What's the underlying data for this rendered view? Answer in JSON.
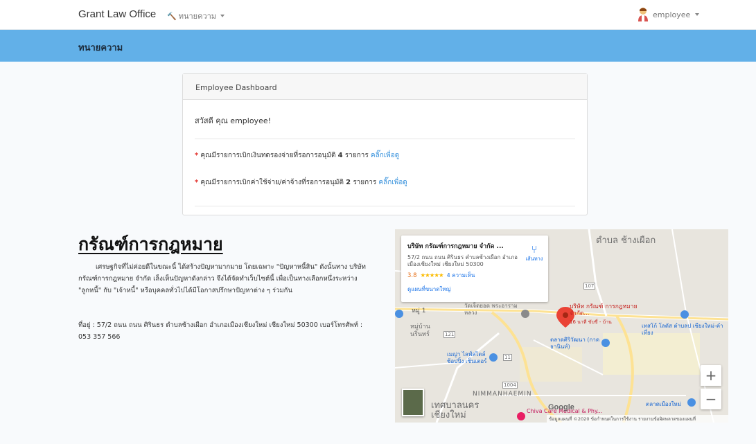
{
  "navbar": {
    "brand": "Grant Law Office",
    "menu_label": "ทนายความ",
    "user_label": "employee"
  },
  "band": {
    "title": "ทนายความ"
  },
  "card": {
    "header": "Employee Dashboard",
    "greeting": "สวัสดี คุณ employee!",
    "notice1": {
      "star": "*",
      "text_before": "คุณมีรายการเบิกเงินทดรองจ่ายที่รอการอนุมัติ",
      "count": "4",
      "text_after": "รายการ",
      "link": "คลิ๊กเพื่อดู"
    },
    "notice2": {
      "star": "*",
      "text_before": "คุณมีรายการเบิกค่าใช้จ่าย/ค่าจ้างที่รอการอนุมัติ",
      "count": "2",
      "text_after": "รายการ",
      "link": "คลิ๊กเพื่อดู"
    }
  },
  "company": {
    "title": "กรัณฑ์การกฎหมาย",
    "description": "เศรษฐกิจที่ไม่ค่อยดีในขณะนี้ ได้สร้างปัญหามากมาย โดยเฉพาะ \"ปัญหาหนี้สิน\" ดังนั้นทาง บริษัท กรัณฑ์การกฎหมาย จำกัด เล็งเห็นปัญหาดังกล่าว จึงได้จัดทำเว็บไซต์นี้ เพื่อเป็นทางเลือกหนึ่งระหว่าง \"ลูกหนี้\" กับ \"เจ้าหนี้\" หรือบุคคลทั่วไปได้มีโอกาสปรึกษาปัญหาต่าง ๆ ร่วมกัน",
    "address": "ที่อยู่ : 57/2 ถนน ถนน ศิรินธร ตำบลช้างเผือก อำเภอเมืองเชียงใหม่ เชียงใหม่ 50300 เบอร์โทรศัพท์ : 053 357 566"
  },
  "map": {
    "info_name": "บริษัท กรัณฑ์การกฎหมาย จำกัด ...",
    "info_address": "57/2 ถนน ถนน ศิรินธร ตำบลช้างเผือก อำเภอเมืองเชียงใหม่ เชียงใหม่ 50300",
    "rating": "3.8",
    "stars": "★★★★★",
    "reviews": "4 ความเห็น",
    "larger_map": "ดูแผนที่ขนาดใหญ่",
    "directions": "เส้นทาง",
    "zoom_in": "+",
    "zoom_out": "−",
    "google": "Google",
    "footer": "ข้อมูลแผนที่ ©2020   ข้อกำหนดในการใช้งาน   รายงานข้อผิดพลาดของแผนที่",
    "labels": {
      "chang_phueak": "ตำบล ช้างเผือก",
      "moo1": "หมู่ 1",
      "wat": "วัดเจ็ดยอด พระอารามหลวง",
      "moo_ban": "หมู่บ้าน นรินทร์",
      "marker": "บริษัท กรัณฑ์ การกฎหมาย จำกัด...",
      "marker_sub": "16 นาที ขับขี่ - บ้าน",
      "talad_siriwattana": "ตลาดศิริวัฒนา (กาดธานินท์)",
      "maya": "เมญ่า ไลฟ์สไตล์ ช้อปปิ้ง เซ็นเตอร์",
      "tesco": "เทสโก้ โลตัส ตำบลป เชียงใหม่-คำเที่ยง",
      "nimman": "NIMMANHAEMIN",
      "thesaban": "เทศบาลนคร เชียงใหม่",
      "chiva": "Chiva Care Medical & Phy...",
      "talad_muang": "ตลาดเมืองใหม่",
      "road_107": "107",
      "road_121": "121",
      "road_11": "11",
      "road_1004": "1004"
    }
  }
}
